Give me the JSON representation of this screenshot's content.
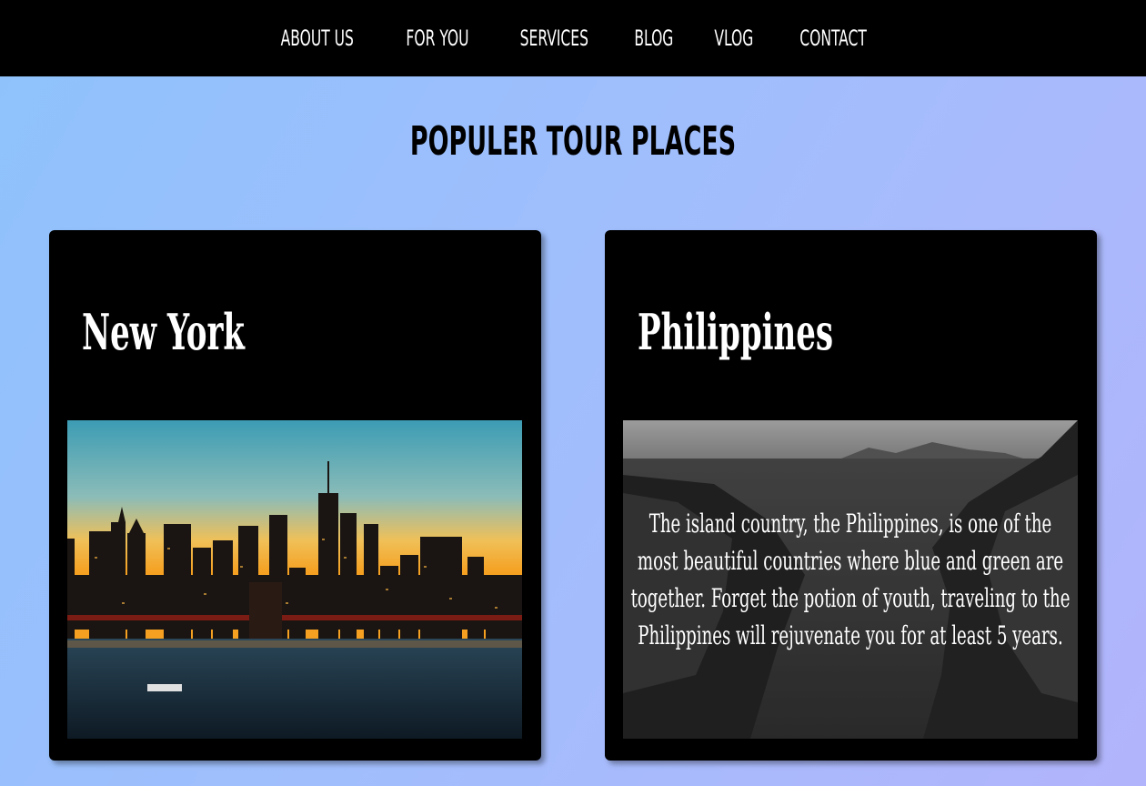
{
  "nav": {
    "items": [
      {
        "label": "ABOUT US"
      },
      {
        "label": "FOR YOU"
      },
      {
        "label": "SERVICES"
      },
      {
        "label": "BLOG"
      },
      {
        "label": "VLOG"
      },
      {
        "label": "CONTACT"
      }
    ]
  },
  "main": {
    "title": "POPULER TOUR PLACES",
    "cards": [
      {
        "title": "New York",
        "image": "new-york-skyline-at-dusk"
      },
      {
        "title": "Philippines",
        "image": "philippines-coast-black-and-white",
        "description": "The island country, the Philippines, is one of the most beautiful countries where blue and green are together. Forget the potion of youth, traveling to the Philippines will rejuvenate you for at least 5 years."
      }
    ]
  }
}
